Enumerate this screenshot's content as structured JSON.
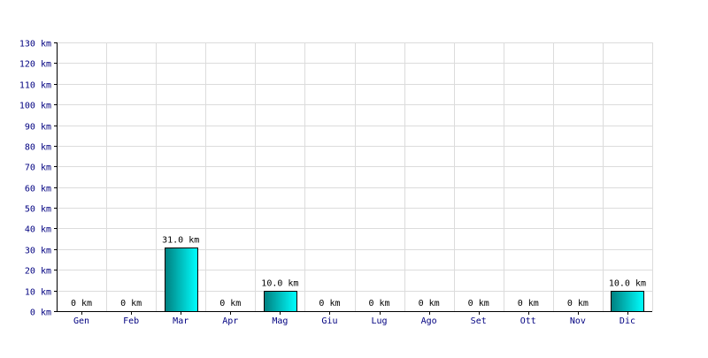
{
  "chart_data": {
    "type": "bar",
    "categories": [
      "Gen",
      "Feb",
      "Mar",
      "Apr",
      "Mag",
      "Giu",
      "Lug",
      "Ago",
      "Set",
      "Ott",
      "Nov",
      "Dic"
    ],
    "values": [
      0,
      0,
      31.0,
      0,
      10.0,
      0,
      0,
      0,
      0,
      0,
      0,
      10.0
    ],
    "data_labels": [
      "0 km",
      "0 km",
      "31.0 km",
      "0 km",
      "10.0 km",
      "0 km",
      "0 km",
      "0 km",
      "0 km",
      "0 km",
      "0 km",
      "10.0 km"
    ],
    "y_ticks": [
      0,
      10,
      20,
      30,
      40,
      50,
      60,
      70,
      80,
      90,
      100,
      110,
      120,
      130
    ],
    "y_tick_labels": [
      "0 km",
      "10 km",
      "20 km",
      "30 km",
      "40 km",
      "50 km",
      "60 km",
      "70 km",
      "80 km",
      "90 km",
      "100 km",
      "110 km",
      "120 km",
      "130 km"
    ],
    "unit": "km",
    "ylim": [
      0,
      130
    ],
    "grid": true,
    "colors": {
      "bar_dark": "#007f7f",
      "bar_light": "#00ffff",
      "axis_text": "#000080",
      "grid": "#dcdcdc"
    },
    "title": "",
    "xlabel": "",
    "ylabel": ""
  }
}
